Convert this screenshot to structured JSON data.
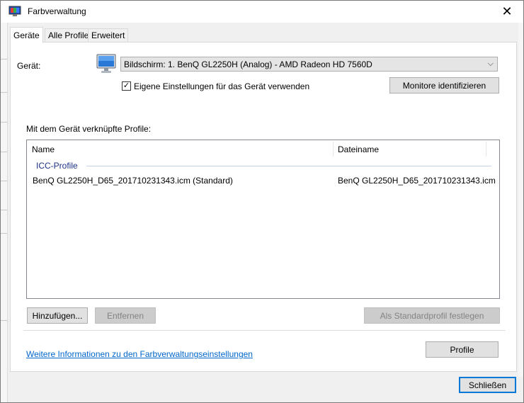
{
  "window": {
    "title": "Farbverwaltung",
    "close_glyph": "✕"
  },
  "tabs": [
    "Geräte",
    "Alle Profile",
    "Erweitert"
  ],
  "device": {
    "label": "Gerät:",
    "selected": "Bildschirm: 1. BenQ GL2250H (Analog) - AMD Radeon HD 7560D",
    "checkbox_label": "Eigene Einstellungen für das Gerät verwenden",
    "checkbox_checked": true,
    "identify_button": "Monitore identifizieren"
  },
  "profiles": {
    "label": "Mit dem Gerät verknüpfte Profile:",
    "columns": [
      "Name",
      "Dateiname"
    ],
    "group": "ICC-Profile",
    "rows": [
      {
        "name": "BenQ GL2250H_D65_201710231343.icm (Standard)",
        "file": "BenQ GL2250H_D65_201710231343.icm"
      }
    ]
  },
  "buttons": {
    "add": "Hinzufügen...",
    "remove": "Entfernen",
    "set_default": "Als Standardprofil festlegen",
    "profile": "Profile",
    "close": "Schließen"
  },
  "link": "Weitere Informationen zu den Farbverwaltungseinstellungen",
  "icons": {
    "app": "color-management-icon",
    "device": "monitor-icon",
    "dropdown": "chevron-down-icon"
  }
}
